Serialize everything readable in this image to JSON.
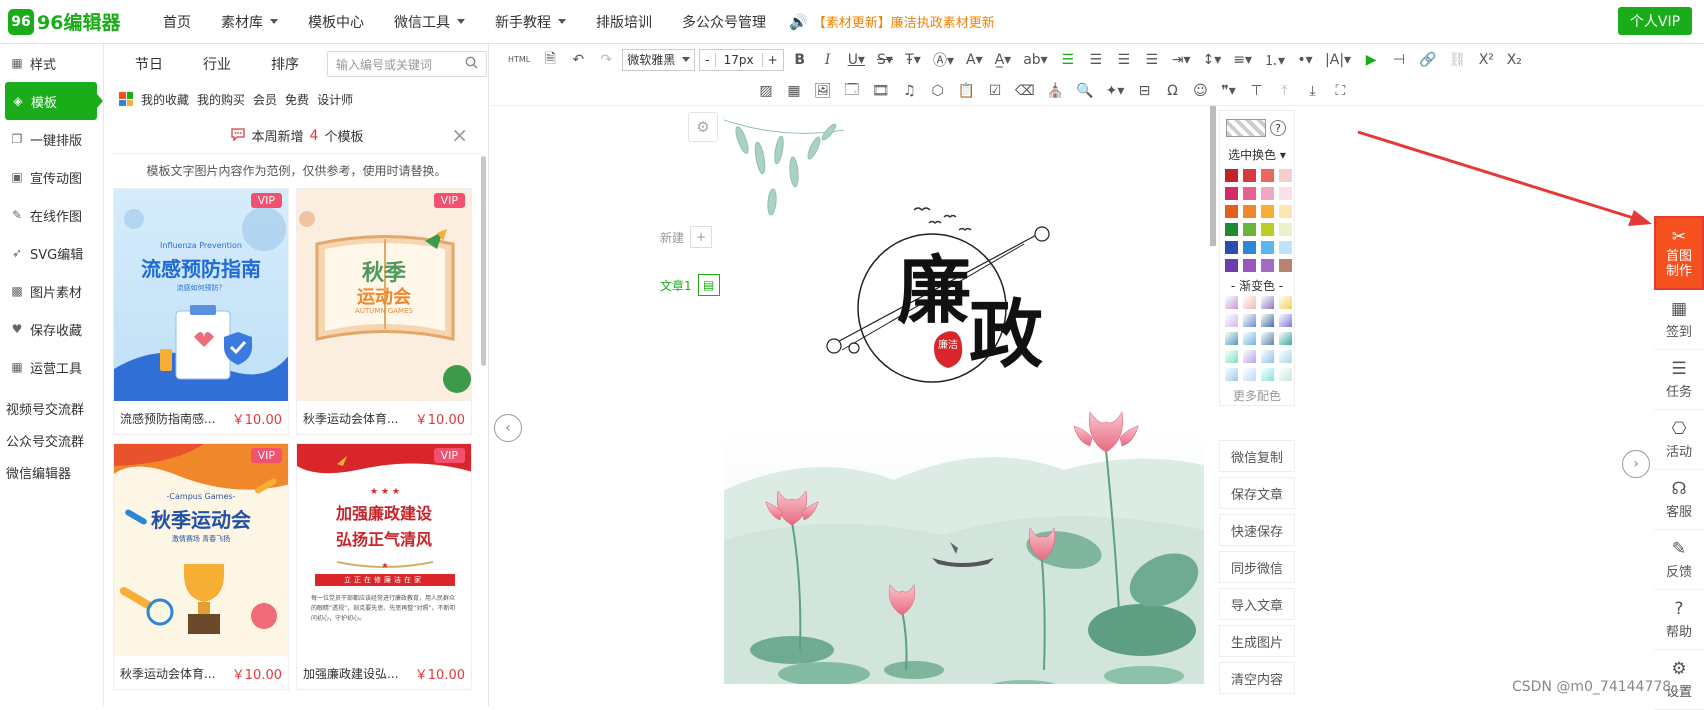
{
  "brand": {
    "logo_mark": "96",
    "logo_text": "96编辑器"
  },
  "nav": [
    {
      "label": "首页",
      "caret": false
    },
    {
      "label": "素材库",
      "caret": true
    },
    {
      "label": "模板中心",
      "caret": false
    },
    {
      "label": "微信工具",
      "caret": true
    },
    {
      "label": "新手教程",
      "caret": true
    },
    {
      "label": "排版培训",
      "caret": false
    },
    {
      "label": "多公众号管理",
      "caret": false
    }
  ],
  "announcement": "【素材更新】廉洁执政素材更新",
  "vip_button": "个人VIP",
  "left_nav": [
    {
      "label": "样式",
      "icon": "grid-icon"
    },
    {
      "label": "模板",
      "icon": "layers-icon",
      "active": true
    },
    {
      "label": "一键排版",
      "icon": "copy-icon"
    },
    {
      "label": "宣传动图",
      "icon": "gif-icon"
    },
    {
      "label": "在线作图",
      "icon": "edit-icon"
    },
    {
      "label": "SVG编辑",
      "icon": "svg-icon"
    },
    {
      "label": "图片素材",
      "icon": "image-icon"
    },
    {
      "label": "保存收藏",
      "icon": "heart-icon"
    },
    {
      "label": "运营工具",
      "icon": "tools-icon"
    }
  ],
  "left_links": [
    "视频号交流群",
    "公众号交流群",
    "微信编辑器"
  ],
  "panel": {
    "tabs": [
      "节日",
      "行业",
      "排序"
    ],
    "search_placeholder": "输入编号或关键词",
    "sub_tabs": [
      "我的收藏",
      "我的购买",
      "会员",
      "免费",
      "设计师"
    ],
    "notice_prefix": "本周新增",
    "notice_count": "4",
    "notice_suffix": "个模板",
    "hint": "模板文字图片内容作为范例，仅供参考，使用时请替换。",
    "cards": [
      {
        "name": "流感预防指南感...",
        "price": "￥10.00",
        "badge": "VIP",
        "thumb_title": "流感预防指南",
        "thumb_sub": "Influenza Prevention",
        "thumb_tag": "流感如何预防？"
      },
      {
        "name": "秋季运动会体育...",
        "price": "￥10.00",
        "badge": "VIP",
        "thumb_title": "秋季",
        "thumb_title2": "运动会",
        "thumb_sub": "AUTUMN GAMES"
      },
      {
        "name": "秋季运动会体育...",
        "price": "￥10.00",
        "badge": "VIP",
        "thumb_title": "秋季运动会",
        "thumb_sub": "-Campus Games-",
        "thumb_tag": "激情赛场  青春飞扬"
      },
      {
        "name": "加强廉政建设弘...",
        "price": "￥10.00",
        "badge": "VIP",
        "thumb_title": "加强廉政建设",
        "thumb_title2": "弘扬正气清风",
        "thumb_tag": "立正在修廉洁在家",
        "thumb_body": "每一位党员干部都应该经常进行廉政教育，用人民群众的眼睛“透视”，刻克要先思、先思再整“对照”，不断叩问初心，守护初心。"
      }
    ]
  },
  "toolbar": {
    "font_family": "微软雅黑",
    "font_size": "17px",
    "minus": "-",
    "plus": "+",
    "html_label": "HTML"
  },
  "editor": {
    "new_label": "新建",
    "article_label": "文章1",
    "poster": {
      "title_1": "廉",
      "title_2": "政",
      "seal": "廉洁"
    }
  },
  "color_panel": {
    "select_label": "选中换色",
    "gradient_label": "- 渐变色 -",
    "more_label": "更多配色",
    "solid_colors": [
      "#c0242a",
      "#d63a3a",
      "#e8685f",
      "#f6cfc8",
      "#d12c63",
      "#e66295",
      "#f1a6c6",
      "#fbe0ea",
      "#e2621b",
      "#f0872b",
      "#f6ae35",
      "#fbe6b4",
      "#1f8a31",
      "#6cb33e",
      "#b9cc28",
      "#e9f2c8",
      "#2a4db0",
      "#2e86d8",
      "#56b8ef",
      "#bfe3f8",
      "#6a3eab",
      "#9b56c0",
      "#a46bc4",
      "#b88270"
    ],
    "gradient_colors": [
      "#c89ad6",
      "#f3b9b0",
      "#8f79c4",
      "#f1d14a",
      "#d6b8ee",
      "#6e8bd0",
      "#466aa8",
      "#7a7ad8",
      "#4f9bb8",
      "#6cb3e0",
      "#5a86b0",
      "#3aa89a",
      "#7be0c0",
      "#b8a4ec",
      "#8ec6e8",
      "#a8d8e8",
      "#9ec8f0",
      "#c0d8f8",
      "#88e0e0",
      "#c8e8d8"
    ]
  },
  "actions": [
    "微信复制",
    "保存文章",
    "快速保存",
    "同步微信",
    "导入文章",
    "生成图片",
    "清空内容"
  ],
  "right_bar": [
    {
      "label": "首图制作",
      "icon": "magic-icon",
      "hot": true
    },
    {
      "label": "签到",
      "icon": "calendar-icon"
    },
    {
      "label": "任务",
      "icon": "task-icon"
    },
    {
      "label": "活动",
      "icon": "gift-icon"
    },
    {
      "label": "客服",
      "icon": "headset-icon"
    },
    {
      "label": "反馈",
      "icon": "feedback-icon"
    },
    {
      "label": "帮助",
      "icon": "help-icon"
    },
    {
      "label": "设置",
      "icon": "settings-icon"
    }
  ],
  "watermark": "CSDN @m0_74144778"
}
